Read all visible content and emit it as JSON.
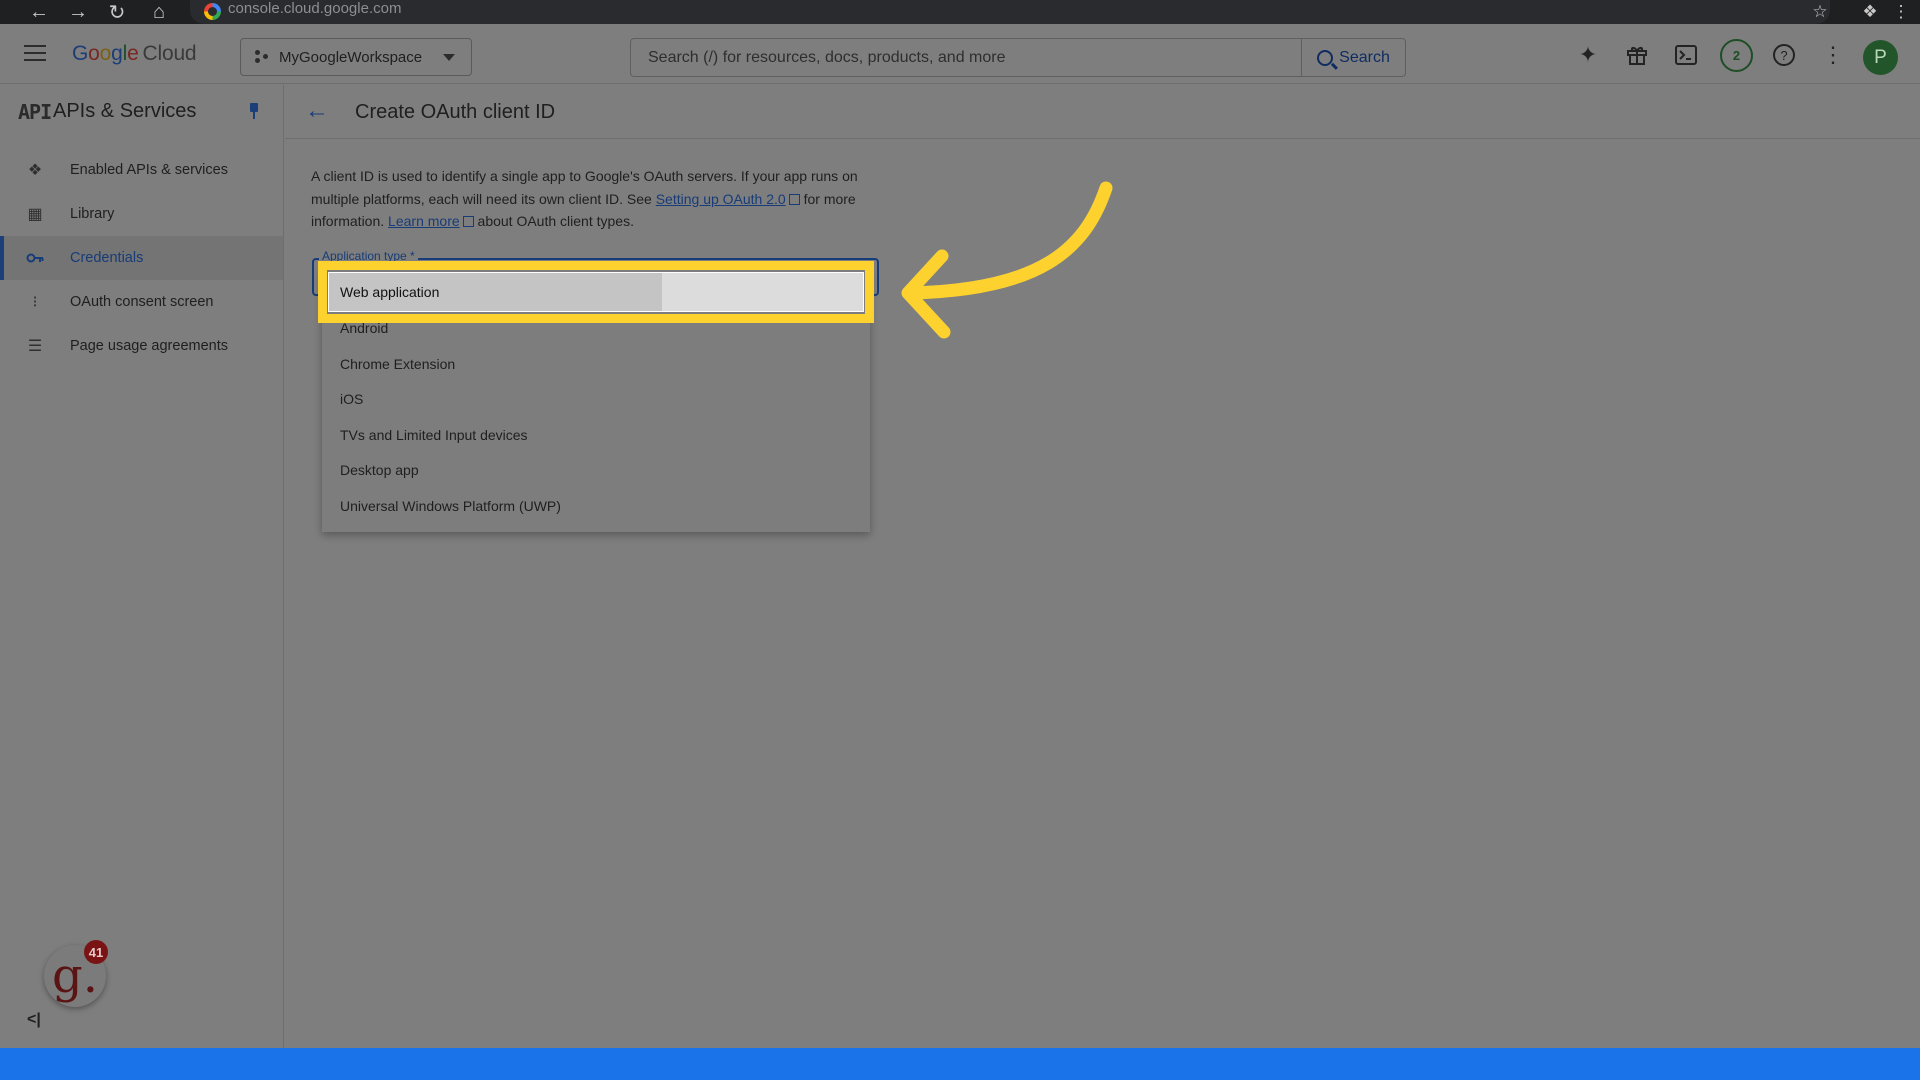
{
  "browser": {
    "url": "console.cloud.google.com",
    "nav_icons": [
      "back-arrow-icon",
      "forward-arrow-icon",
      "reload-icon",
      "home-icon"
    ],
    "right_icons": [
      "star-icon",
      "puzzle-icon",
      "kebab-icon"
    ]
  },
  "header": {
    "brand_letters": [
      "G",
      "o",
      "o",
      "g",
      "l",
      "e"
    ],
    "brand_suffix": "Cloud",
    "project": "MyGoogleWorkspace",
    "search_placeholder": "Search (/) for resources, docs, products, and more",
    "search_button": "Search",
    "notification_count": "2",
    "avatar_letter": "P"
  },
  "sidebar": {
    "logo": "API",
    "title": "APIs & Services",
    "items": [
      {
        "label": "Enabled APIs & services",
        "icon": "diamond-dots-icon",
        "active": false
      },
      {
        "label": "Library",
        "icon": "library-grid-icon",
        "active": false
      },
      {
        "label": "Credentials",
        "icon": "key-icon",
        "active": true
      },
      {
        "label": "OAuth consent screen",
        "icon": "consent-icon",
        "active": false
      },
      {
        "label": "Page usage agreements",
        "icon": "settings-list-icon",
        "active": false
      }
    ],
    "guidde_badge": "41",
    "guidde_letter": "g."
  },
  "main": {
    "title": "Create OAuth client ID",
    "description": {
      "part1": "A client ID is used to identify a single app to Google's OAuth servers. If your app runs on multiple platforms, each will need its own client ID. See ",
      "link1": "Setting up OAuth 2.0",
      "part2": " for more information. ",
      "link2": "Learn more",
      "part3": " about OAuth client types."
    },
    "field_label": "Application type *",
    "options": [
      "Web application",
      "Android",
      "Chrome Extension",
      "iOS",
      "TVs and Limited Input devices",
      "Desktop app",
      "Universal Windows Platform (UWP)"
    ]
  },
  "colors": {
    "accent": "#1c3f7a",
    "highlight": "#fdd22f",
    "bottom_bar": "#1a73e8"
  }
}
